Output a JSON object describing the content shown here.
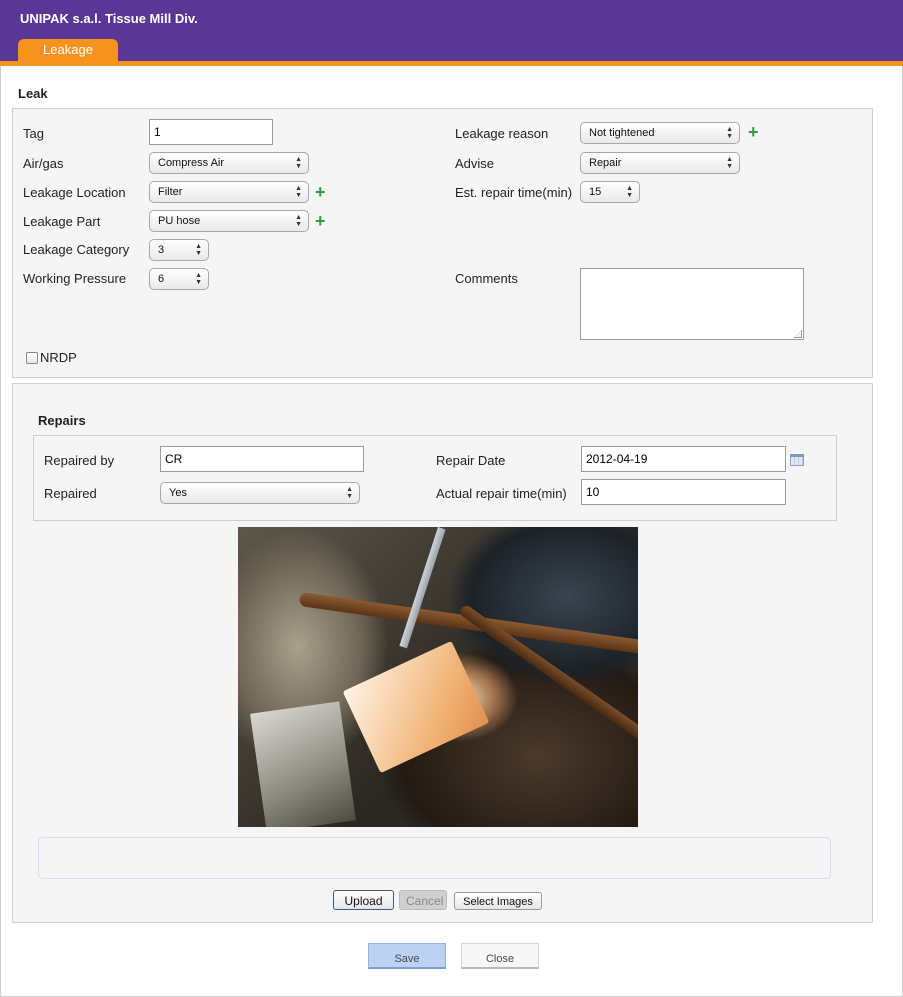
{
  "app": {
    "title": "UNIPAK s.a.l. Tissue Mill Div."
  },
  "tabs": [
    {
      "label": "Leakage"
    }
  ],
  "leak": {
    "section_title": "Leak",
    "tag": {
      "label": "Tag",
      "value": "1"
    },
    "air_gas": {
      "label": "Air/gas",
      "value": "Compress Air"
    },
    "location": {
      "label": "Leakage Location",
      "value": "Filter"
    },
    "part": {
      "label": "Leakage Part",
      "value": "PU hose"
    },
    "category": {
      "label": "Leakage Category",
      "value": "3"
    },
    "pressure": {
      "label": "Working Pressure",
      "value": "6"
    },
    "reason": {
      "label": "Leakage reason",
      "value": "Not tightened"
    },
    "advise": {
      "label": "Advise",
      "value": "Repair"
    },
    "est_time": {
      "label": "Est. repair time(min)",
      "value": "15"
    },
    "comments": {
      "label": "Comments",
      "value": ""
    },
    "nrdp": {
      "label": "NRDP",
      "checked": false
    }
  },
  "repairs": {
    "section_title": "Repairs",
    "repaired_by": {
      "label": "Repaired by",
      "value": "CR"
    },
    "repaired": {
      "label": "Repaired",
      "value": "Yes"
    },
    "repair_date": {
      "label": "Repair Date",
      "value": "2012-04-19"
    },
    "actual_time": {
      "label": "Actual repair time(min)",
      "value": "10"
    }
  },
  "uploader": {
    "upload_label": "Upload",
    "cancel_label": "Cancel",
    "select_label": "Select Images"
  },
  "footer": {
    "save_label": "Save",
    "close_label": "Close"
  },
  "icons": {
    "plus": "+",
    "arrow_up": "▲",
    "arrow_down": "▼"
  },
  "colors": {
    "header_bg": "#5a3696",
    "tab_accent": "#f6931e",
    "plus_green": "#2e9e3e"
  }
}
